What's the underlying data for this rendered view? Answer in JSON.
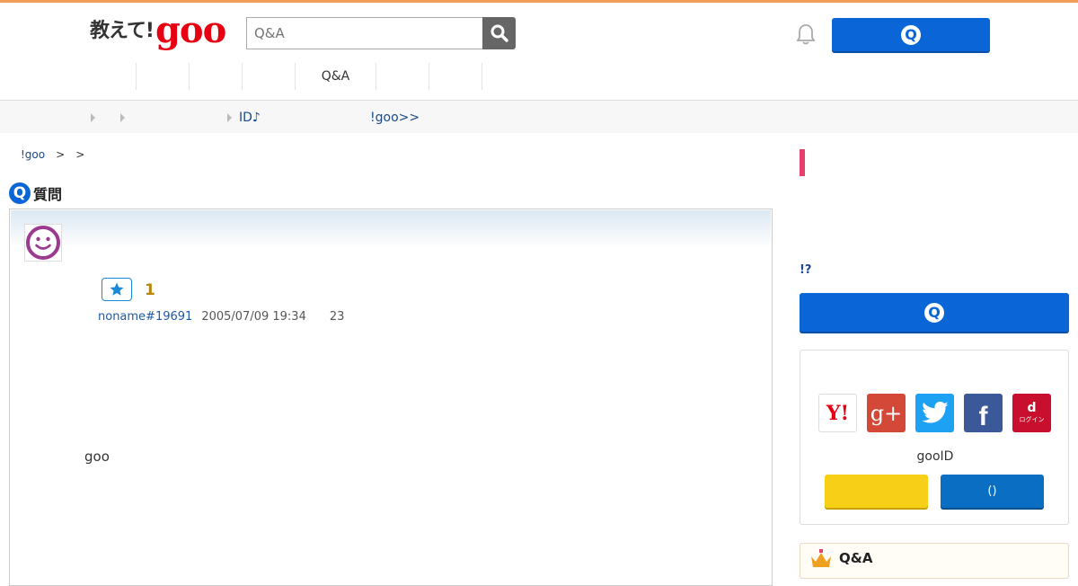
{
  "header": {
    "logo_text_jp": "教えて!",
    "logo_text_goo": "goo",
    "search_placeholder": "Q&A",
    "ask_button_badge": "Q"
  },
  "global_nav": {
    "items": [
      "",
      "",
      "",
      "",
      "Q&A",
      "",
      ""
    ]
  },
  "sub_nav": {
    "items": [
      "",
      "",
      "ID♪",
      "!goo>>"
    ]
  },
  "breadcrumb": {
    "home": "!goo",
    "sep1": ">",
    "sep2": ">"
  },
  "question": {
    "section_badge": "Q",
    "section_title": "質問",
    "favorite_count": "1",
    "username": "noname#19691",
    "datetime": "2005/07/09 19:34",
    "views": "23",
    "body": "goo"
  },
  "sidebar": {
    "question_link": "!?",
    "ask_button_badge": "Q",
    "sns": [
      "Y!",
      "g+",
      "twitter",
      "f",
      "d"
    ],
    "docomo_label": "ログイン",
    "gooid_label": "gooID",
    "blue_button_label": "()",
    "qa_title": "Q&A"
  },
  "colors": {
    "brand_blue": "#0a66d6",
    "goo_red": "#e60012",
    "accent_orange": "#f39c5a",
    "accent_pink": "#e5406e",
    "yellow_button": "#f7cf16"
  }
}
